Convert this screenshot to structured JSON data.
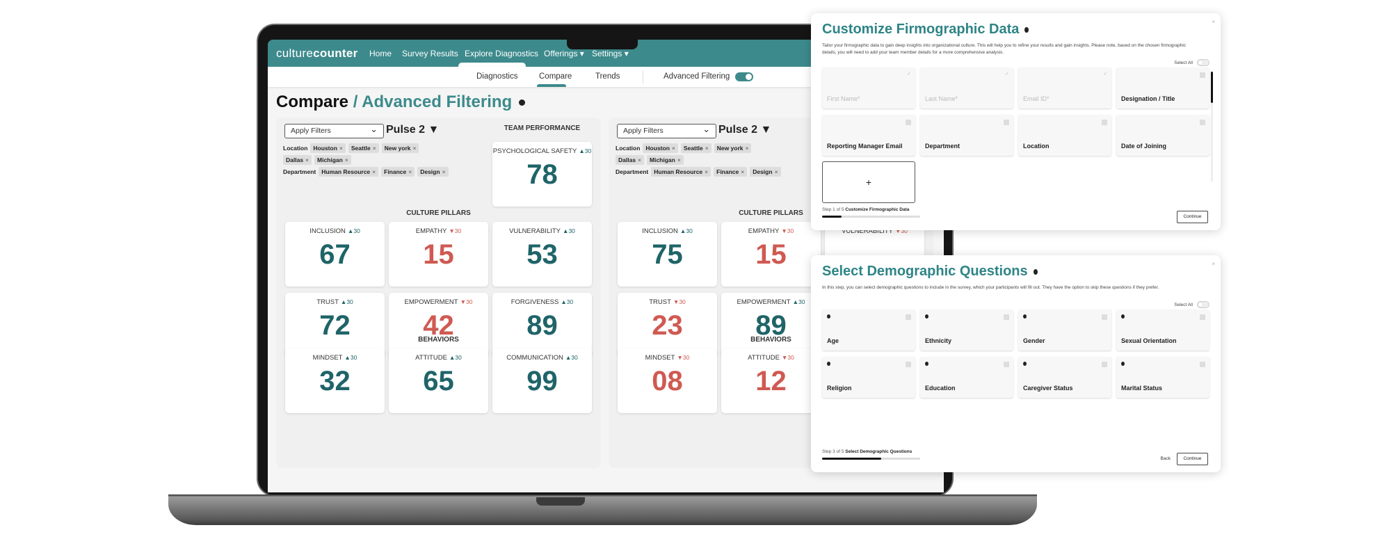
{
  "app": {
    "logo_light": "culture",
    "logo_bold": "counter"
  },
  "nav": {
    "items": [
      "Home",
      "Survey Results",
      "Explore Diagnostics",
      "Offerings ▾",
      "Settings ▾"
    ],
    "active": "Explore Diagnostics"
  },
  "subnav": {
    "tabs": [
      "Diagnostics",
      "Compare",
      "Trends"
    ],
    "active": "Compare",
    "advanced_filtering_label": "Advanced Filtering",
    "advanced_filtering_on": true
  },
  "page": {
    "title_main": "Compare",
    "title_sub": " / Advanced Filtering"
  },
  "colors": {
    "brand": "#3d8a8c",
    "positive": "#1f6468",
    "negative": "#cf5a52"
  },
  "panels": [
    {
      "filter_placeholder": "Apply Filters",
      "pulse": "Pulse 2 ▼",
      "location_label": "Location",
      "locations": [
        "Houston",
        "Seattle",
        "New york",
        "Dallas",
        "Michigan"
      ],
      "department_label": "Department",
      "departments": [
        "Human Resource",
        "Finance",
        "Design"
      ],
      "team_title": "TEAM PERFORMANCE",
      "team": {
        "label": "PSYCHOLOGICAL SAFETY",
        "delta": "30",
        "dir": "up",
        "value": "78"
      },
      "pillars_title": "CULTURE PILLARS",
      "pillars": [
        {
          "label": "INCLUSION",
          "delta": "30",
          "dir": "up",
          "value": "67"
        },
        {
          "label": "EMPATHY",
          "delta": "30",
          "dir": "down",
          "value": "15"
        },
        {
          "label": "VULNERABILITY",
          "delta": "30",
          "dir": "up",
          "value": "53"
        },
        {
          "label": "TRUST",
          "delta": "30",
          "dir": "up",
          "value": "72"
        },
        {
          "label": "EMPOWERMENT",
          "delta": "30",
          "dir": "down",
          "value": "42"
        },
        {
          "label": "FORGIVENESS",
          "delta": "30",
          "dir": "up",
          "value": "89"
        }
      ],
      "behaviors_title": "BEHAVIORS",
      "behaviors": [
        {
          "label": "MINDSET",
          "delta": "30",
          "dir": "up",
          "value": "32"
        },
        {
          "label": "ATTITUDE",
          "delta": "30",
          "dir": "up",
          "value": "65"
        },
        {
          "label": "COMMUNICATION",
          "delta": "30",
          "dir": "up",
          "value": "99"
        }
      ]
    },
    {
      "filter_placeholder": "Apply Filters",
      "pulse": "Pulse 2 ▼",
      "location_label": "Location",
      "locations": [
        "Houston",
        "Seattle",
        "New york",
        "Dallas",
        "Michigan"
      ],
      "department_label": "Department",
      "departments": [
        "Human Resource",
        "Finance",
        "Design"
      ],
      "pillars_title": "CULTURE PILLARS",
      "pillars": [
        {
          "label": "INCLUSION",
          "delta": "30",
          "dir": "up",
          "value": "75"
        },
        {
          "label": "EMPATHY",
          "delta": "30",
          "dir": "down",
          "value": "15"
        },
        {
          "label": "VULNERABILITY",
          "delta": "30",
          "dir": "down",
          "value": ""
        },
        {
          "label": "TRUST",
          "delta": "30",
          "dir": "down",
          "value": "23"
        },
        {
          "label": "EMPOWERMENT",
          "delta": "30",
          "dir": "up",
          "value": "89"
        }
      ],
      "behaviors_title": "BEHAVIORS",
      "behaviors": [
        {
          "label": "MINDSET",
          "delta": "30",
          "dir": "down",
          "value": "08"
        },
        {
          "label": "ATTITUDE",
          "delta": "30",
          "dir": "down",
          "value": "12"
        }
      ]
    }
  ],
  "firmographic": {
    "title": "Customize Firmographic Data",
    "close": "×",
    "description": "Tailor your firmographic data to gain deep insights into organizational culture. This will help you to refine your results and gain insights. Please note, based on the chosen firmographic details, you will need to add your team member details for a more comprehensive analysis.",
    "select_all": "Select All",
    "fields": [
      {
        "label": "First Name*",
        "required": true
      },
      {
        "label": "Last Name*",
        "required": true
      },
      {
        "label": "Email ID*",
        "required": true
      },
      {
        "label": "Designation / Title"
      },
      {
        "label": "Reporting Manager Email"
      },
      {
        "label": "Department"
      },
      {
        "label": "Location"
      },
      {
        "label": "Date of Joining"
      }
    ],
    "add_label": "+",
    "step_text": "Step 1 of 5",
    "step_name": "Customize Firmographic Data",
    "progress": 0.2,
    "continue": "Continue"
  },
  "demographic": {
    "title": "Select Demographic Questions",
    "close": "×",
    "description": "In this step, you can select demographic questions to include in the survey, which your participants will fill out. They have the option to skip these questions if they prefer.",
    "select_all": "Select All",
    "fields": [
      {
        "label": "Age"
      },
      {
        "label": "Ethnicity"
      },
      {
        "label": "Gender"
      },
      {
        "label": "Sexual Orientation"
      },
      {
        "label": "Religion"
      },
      {
        "label": "Education"
      },
      {
        "label": "Caregiver Status"
      },
      {
        "label": "Marital Status"
      }
    ],
    "step_text": "Step 3 of 5",
    "step_name": "Select Demographic Questions",
    "progress": 0.6,
    "back": "Back",
    "continue": "Continue"
  }
}
